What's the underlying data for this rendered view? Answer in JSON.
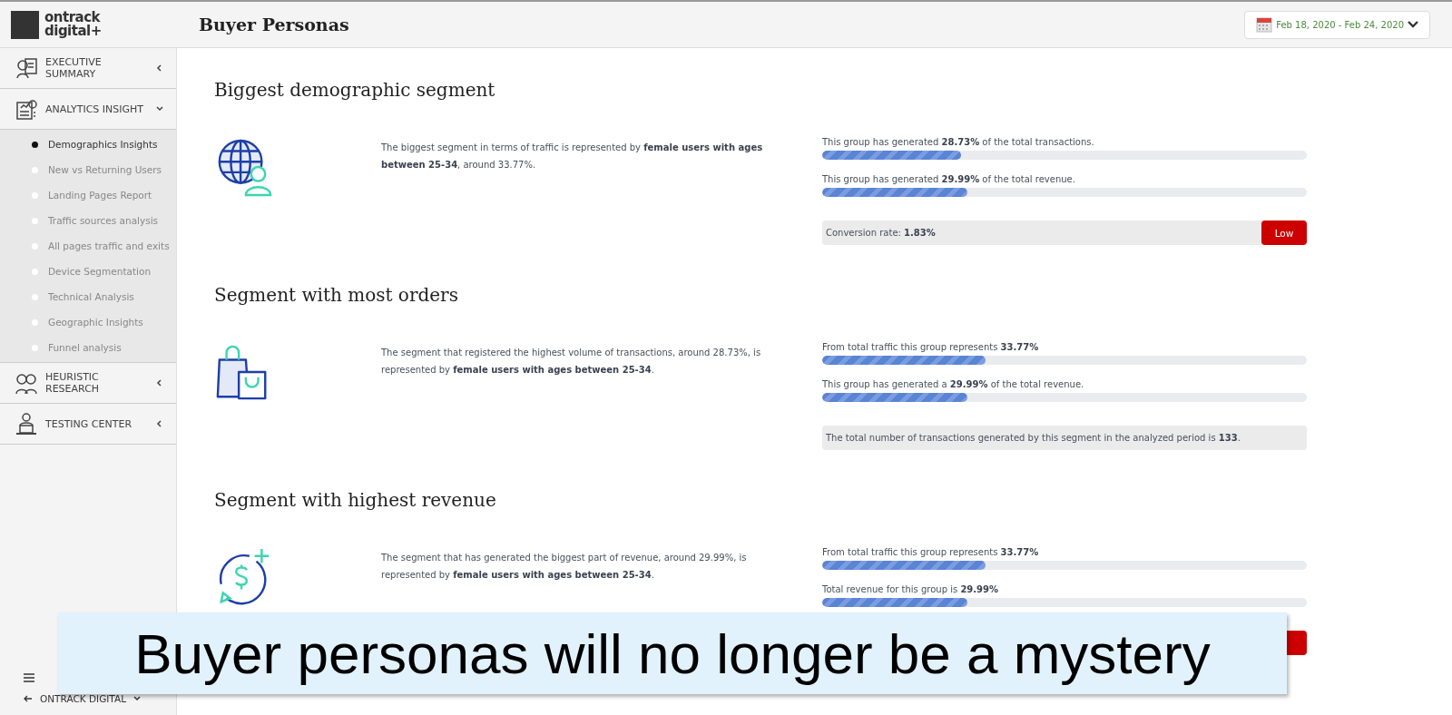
{
  "logo": {
    "line1": "ontrack",
    "line2": "digital+"
  },
  "header": {
    "title": "Buyer Personas",
    "date_range": "Feb 18, 2020 - Feb 24, 2020"
  },
  "sidebar": {
    "groups": [
      {
        "label": "EXECUTIVE SUMMARY",
        "expanded": false
      },
      {
        "label": "ANALYTICS INSIGHT",
        "expanded": true,
        "items": [
          {
            "label": "Demographics Insights",
            "selected": true
          },
          {
            "label": "New vs Returning Users",
            "selected": false
          },
          {
            "label": "Landing Pages Report",
            "selected": false
          },
          {
            "label": "Traffic sources analysis",
            "selected": false
          },
          {
            "label": "All pages traffic and exits",
            "selected": false
          },
          {
            "label": "Device Segmentation",
            "selected": false
          },
          {
            "label": "Technical Analysis",
            "selected": false
          },
          {
            "label": "Geographic Insights",
            "selected": false
          },
          {
            "label": "Funnel analysis",
            "selected": false
          }
        ]
      },
      {
        "label": "HEURISTIC RESEARCH",
        "expanded": false
      },
      {
        "label": "TESTING CENTER",
        "expanded": false
      }
    ],
    "footer": {
      "label": "ONTRACK DIGITAL"
    }
  },
  "sections": [
    {
      "title": "Biggest demographic segment",
      "description": "The biggest segment in terms of traffic is represented by **female users with ages between 25-34**, around 33.77%.",
      "stats": [
        {
          "kind": "bar",
          "text": "This group has generated **28.73%** of the total transactions.",
          "level": 0.2873
        },
        {
          "kind": "bar",
          "text": "This group has generated **29.99%** of the total revenue.",
          "level": 0.2999
        },
        {
          "kind": "rating",
          "text": "Conversion rate: **1.83%**",
          "badge": "Low"
        }
      ]
    },
    {
      "title": "Segment with most orders",
      "description": "The segment that registered the highest volume of transactions, around 28.73%, is represented by **female users with ages between 25-34**.",
      "stats": [
        {
          "kind": "bar",
          "text": "From total traffic this group represents **33.77%**",
          "level": 0.3377
        },
        {
          "kind": "bar",
          "text": "This group has generated a **29.99%** of the total revenue.",
          "level": 0.2999
        },
        {
          "kind": "note",
          "text": "The total number of transactions generated by this segment in the analyzed period is **133**."
        }
      ]
    },
    {
      "title": "Segment with highest revenue",
      "description": "The segment that has generated the biggest part of revenue, around 29.99%, is represented by **female users with ages between 25-34**.",
      "stats": [
        {
          "kind": "bar",
          "text": "From total traffic this group represents **33.77%**",
          "level": 0.3377
        },
        {
          "kind": "bar",
          "text": "Total revenue for this group is **29.99%**",
          "level": 0.2999
        },
        {
          "kind": "rating"
        }
      ]
    }
  ],
  "caption": "Buyer personas will no longer be a mystery"
}
